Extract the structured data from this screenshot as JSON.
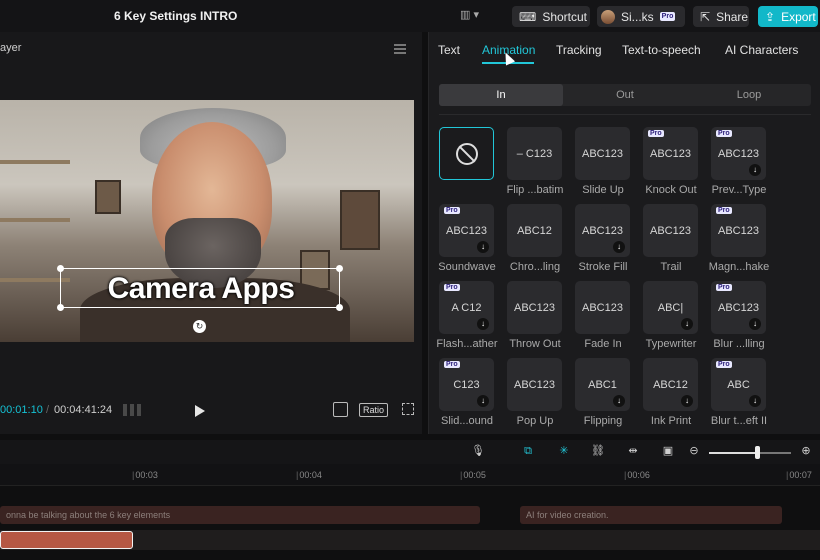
{
  "topbar": {
    "title": "6 Key Settings INTRO",
    "shortcut_label": "Shortcut",
    "user_name": "Si...ks",
    "user_badge": "Pro",
    "share_label": "Share",
    "export_label": "Export"
  },
  "player": {
    "header": "ayer",
    "caption": "Camera Apps",
    "current_time": "00:01:10",
    "total_time": "00:04:41:24",
    "ratio_label": "Ratio"
  },
  "panel": {
    "tabs": [
      "Text",
      "Animation",
      "Tracking",
      "Text-to-speech",
      "AI Characters"
    ],
    "active_tab": "Animation",
    "segments": [
      "In",
      "Out",
      "Loop"
    ],
    "active_segment": "In",
    "animations": [
      {
        "label": "",
        "preview": "",
        "pro": false,
        "download": false,
        "selected": true
      },
      {
        "label": "Flip ...batim",
        "preview": "– C123",
        "pro": false,
        "download": false
      },
      {
        "label": "Slide Up",
        "preview": "ABC123",
        "pro": false,
        "download": false
      },
      {
        "label": "Knock Out",
        "preview": "ABC123",
        "pro": true,
        "download": false
      },
      {
        "label": "Prev...Type",
        "preview": "ABC123",
        "pro": true,
        "download": true
      },
      {
        "label": "Soundwave",
        "preview": "ABC123",
        "pro": true,
        "download": true
      },
      {
        "label": "Chro...ling",
        "preview": "ABC12",
        "pro": false,
        "download": false
      },
      {
        "label": "Stroke Fill",
        "preview": "ABC123",
        "pro": false,
        "download": true
      },
      {
        "label": "Trail",
        "preview": "ABC123",
        "pro": false,
        "download": false
      },
      {
        "label": "Magn...hake",
        "preview": "ABC123",
        "pro": true,
        "download": false
      },
      {
        "label": "Flash...ather",
        "preview": "A  C12",
        "pro": true,
        "download": true
      },
      {
        "label": "Throw Out",
        "preview": "ABC123",
        "pro": false,
        "download": false
      },
      {
        "label": "Fade In",
        "preview": "ABC123",
        "pro": false,
        "download": false
      },
      {
        "label": "Typewriter",
        "preview": "ABC|",
        "pro": false,
        "download": true
      },
      {
        "label": "Blur ...lling",
        "preview": "ABC123",
        "pro": true,
        "download": true
      },
      {
        "label": "Slid...ound",
        "preview": "C123",
        "pro": true,
        "download": true
      },
      {
        "label": "Pop Up",
        "preview": "ABC123",
        "pro": false,
        "download": false
      },
      {
        "label": "Flipping",
        "preview": "ABC1",
        "pro": false,
        "download": true
      },
      {
        "label": "Ink Print",
        "preview": "ABC12",
        "pro": false,
        "download": true
      },
      {
        "label": "Blur t...eft II",
        "preview": "ABC",
        "pro": true,
        "download": true
      }
    ]
  },
  "timeline": {
    "ticks": [
      "00:03",
      "00:04",
      "00:05",
      "00:06",
      "00:07"
    ],
    "subtitle_1": "onna be talking about the 6 key elements",
    "subtitle_2": "AI for video creation."
  },
  "colors": {
    "accent": "#22c7d8",
    "export": "#12b8c9",
    "clip": "#b55743"
  }
}
